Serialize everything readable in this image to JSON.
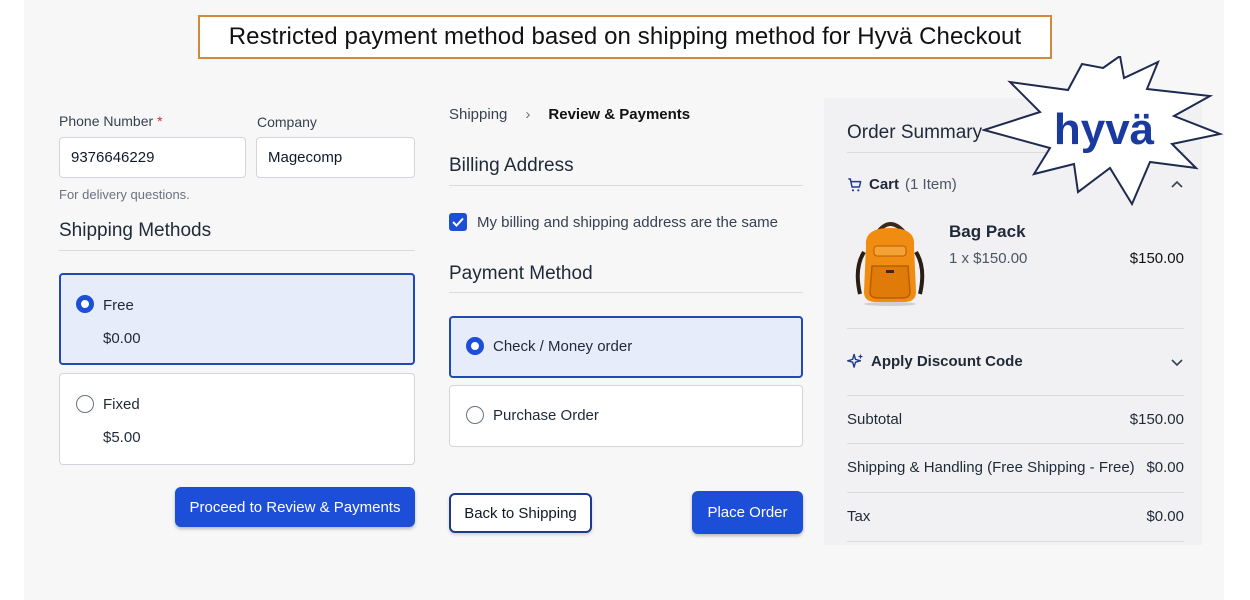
{
  "banner": {
    "title": "Restricted payment method based on shipping method for Hyvä Checkout"
  },
  "logo": {
    "text": "hyvä"
  },
  "shipping_form": {
    "phone_label": "Phone Number",
    "phone_required": "*",
    "phone_value": "9376646229",
    "company_label": "Company",
    "company_value": "Magecomp",
    "phone_hint": "For delivery questions."
  },
  "shipping_methods": {
    "heading": "Shipping Methods",
    "options": [
      {
        "title": "Free",
        "price": "$0.00",
        "selected": true
      },
      {
        "title": "Fixed",
        "price": "$5.00",
        "selected": false
      }
    ],
    "proceed_label": "Proceed to Review & Payments"
  },
  "breadcrumb": {
    "step1": "Shipping",
    "separator": "›",
    "step2": "Review & Payments"
  },
  "billing": {
    "heading": "Billing Address",
    "same_address_label": "My billing and shipping address are the same",
    "same_address_checked": true
  },
  "payment": {
    "heading": "Payment Method",
    "options": [
      {
        "title": "Check / Money order",
        "selected": true
      },
      {
        "title": "Purchase Order",
        "selected": false
      }
    ],
    "back_label": "Back to Shipping",
    "place_order_label": "Place Order"
  },
  "order_summary": {
    "heading": "Order Summary",
    "cart_label": "Cart",
    "cart_count": "(1 Item)",
    "item": {
      "name": "Bag Pack",
      "qty_price": "1 x $150.00",
      "total": "$150.00"
    },
    "discount_label": "Apply Discount Code",
    "rows": [
      {
        "label": "Subtotal",
        "value": "$150.00"
      },
      {
        "label": "Shipping & Handling (Free Shipping - Free)",
        "value": "$0.00"
      },
      {
        "label": "Tax",
        "value": "$0.00"
      }
    ]
  },
  "colors": {
    "accent": "#1d4ed8",
    "banner_border": "#d4883a",
    "required": "#dc2626"
  }
}
